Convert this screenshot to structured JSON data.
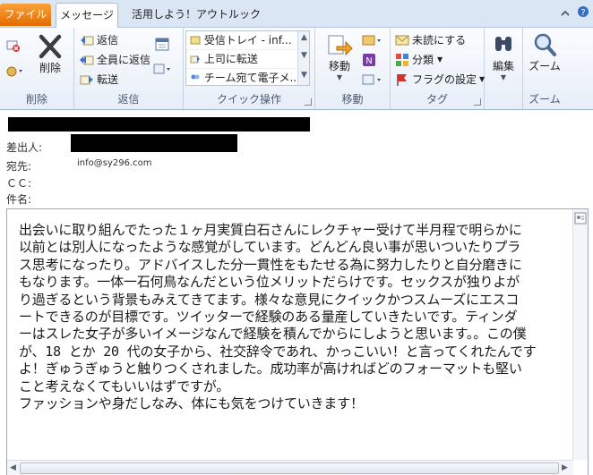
{
  "tabs": {
    "file": "ファイル",
    "message": "メッセージ",
    "utilize": "活用しよう！アウトルック"
  },
  "groups": {
    "delete": {
      "label": "削除",
      "delete_button": "削除"
    },
    "respond": {
      "label": "返信",
      "reply": "返信",
      "reply_all": "全員に返信",
      "forward": "転送"
    },
    "quick_steps": {
      "label": "クイック操作",
      "items": [
        "受信トレイ - inf...",
        "上司に転送",
        "チーム宛て電子メ..."
      ]
    },
    "move": {
      "label": "移動",
      "move_button": "移動"
    },
    "tags": {
      "label": "タグ",
      "mark_unread": "未読にする",
      "categorize": "分類",
      "follow_up": "フラグの設定"
    },
    "editing": {
      "label": "",
      "edit_button": "編集"
    },
    "zoom": {
      "label": "ズーム",
      "zoom_button": "ズーム"
    }
  },
  "header": {
    "from_label": "差出人:",
    "to_label": "宛先:",
    "to_value": "info@sy296.com",
    "cc_label": "ＣＣ:",
    "subject_label": "件名:"
  },
  "body": {
    "text": "出会いに取り組んでたった１ヶ月実質白石さんにレクチャー受けて半月程で明らかに\n以前とは別人になったような感覚がしています。どんどん良い事が思いついたりプラ\nス思考になったり。アドバイスした分一貫性をもたせる為に努力したりと自分磨きに\nもなります。一体一石何鳥なんだという位メリットだらけです。セックスが独りよが\nり過ぎるという背景もみえてきてます。様々な意見にクイックかつスムーズにエスコ\nートできるのが目標です。ツイッターで経験のある量産していきたいです。ティンダ\nーはスレた女子が多いイメージなんで経験を積んでからにしようと思います。。この僕\nが、18 とか 20 代の女子から、社交辞令であれ、かっこいい！と言ってくれたんです\nよ！ぎゅうぎゅうと触りつくされました。成功率が高ければどのフォーマットも堅い\nこと考えなくてもいいはずですが。\nファッションや身だしなみ、体にも気をつけていきます！"
  },
  "colors": {
    "file_tab": "#e36b00",
    "ribbon_bg": "#e7eef8",
    "text": "#1a1a1a"
  }
}
